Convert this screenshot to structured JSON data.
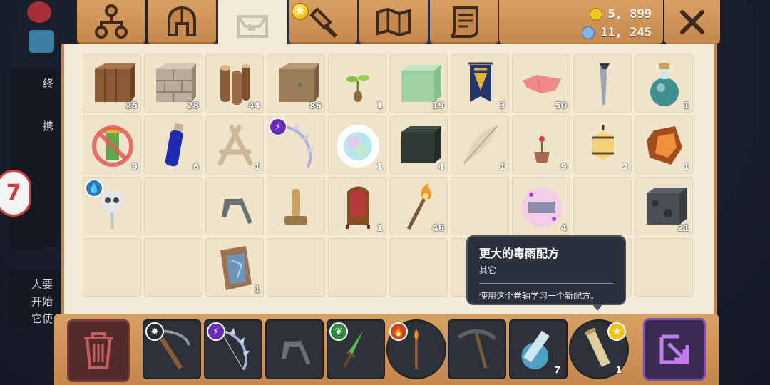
{
  "tabs": [
    {
      "name": "skills",
      "icon": "skill-tree-icon"
    },
    {
      "name": "equipment",
      "icon": "helmet-icon"
    },
    {
      "name": "inventory",
      "icon": "bag-icon",
      "active": true
    },
    {
      "name": "crafting",
      "icon": "hammer-icon",
      "has_star": true
    },
    {
      "name": "map",
      "icon": "map-icon"
    },
    {
      "name": "quests",
      "icon": "scroll-icon"
    }
  ],
  "currency": {
    "gold": "5, 899",
    "gems": "11, 245"
  },
  "inventory": {
    "rows": [
      [
        {
          "icon": "wood-block-icon",
          "count": "25"
        },
        {
          "icon": "stone-brick-icon",
          "count": "28"
        },
        {
          "icon": "logs-icon",
          "count": "44"
        },
        {
          "icon": "dirt-block-icon",
          "count": "86"
        },
        {
          "icon": "seedling-icon",
          "count": "1"
        },
        {
          "icon": "green-block-icon",
          "count": "19"
        },
        {
          "icon": "banner-icon",
          "count": "3"
        },
        {
          "icon": "pink-paper-icon",
          "count": "50"
        },
        {
          "icon": "metal-spike-icon",
          "count": ""
        },
        {
          "icon": "potion-icon",
          "count": "1"
        }
      ],
      [
        {
          "icon": "totem-forbidden-icon",
          "count": "9"
        },
        {
          "icon": "blue-vial-icon",
          "count": "6"
        },
        {
          "icon": "bone-frame-icon",
          "count": "1"
        },
        {
          "icon": "crystal-bow-icon",
          "count": "",
          "badge": "lightning"
        },
        {
          "icon": "rainbow-orb-icon",
          "count": "1"
        },
        {
          "icon": "dark-block-icon",
          "count": "4"
        },
        {
          "icon": "feather-icon",
          "count": "1"
        },
        {
          "icon": "flower-pot-icon",
          "count": "9"
        },
        {
          "icon": "lantern-icon",
          "count": "2"
        },
        {
          "icon": "amber-ore-icon",
          "count": "1"
        }
      ],
      [
        {
          "icon": "skull-staff-icon",
          "count": "",
          "badge": "water"
        },
        {
          "icon": "",
          "count": ""
        },
        {
          "icon": "flintlock-icon",
          "count": ""
        },
        {
          "icon": "brass-key-icon",
          "count": ""
        },
        {
          "icon": "throne-icon",
          "count": "1"
        },
        {
          "icon": "torch-icon",
          "count": "46"
        },
        {
          "icon": "",
          "count": ""
        },
        {
          "icon": "magic-scroll-icon",
          "count": "4"
        },
        {
          "icon": "",
          "count": ""
        },
        {
          "icon": "cobblestone-block-icon",
          "count": "21"
        }
      ],
      [
        {
          "icon": "",
          "count": ""
        },
        {
          "icon": "",
          "count": ""
        },
        {
          "icon": "",
          "count": ""
        },
        {
          "icon": "",
          "count": ""
        },
        {
          "icon": "",
          "count": ""
        },
        {
          "icon": "",
          "count": ""
        },
        {
          "icon": "",
          "count": ""
        },
        {
          "icon": "",
          "count": ""
        },
        {
          "icon": "",
          "count": ""
        },
        {
          "icon": "",
          "count": ""
        }
      ]
    ],
    "extra_item": {
      "row": 4,
      "col": 3,
      "icon": "crystal-shield-icon",
      "count": "1"
    }
  },
  "tooltip": {
    "title": "更大的毒雨配方",
    "category": "其它",
    "description": "使用这个卷轴学习一个新配方。"
  },
  "hotbar": [
    {
      "icon": "crossbow-icon",
      "count": "",
      "badge": "sun",
      "shape": "square"
    },
    {
      "icon": "crystal-bow-icon",
      "count": "",
      "badge": "lightning",
      "shape": "square"
    },
    {
      "icon": "flintlock-icon",
      "count": "",
      "badge": "",
      "shape": "square"
    },
    {
      "icon": "green-dagger-icon",
      "count": "",
      "badge": "leaf",
      "shape": "square"
    },
    {
      "icon": "fire-wand-icon",
      "count": "",
      "badge": "fire",
      "shape": "round"
    },
    {
      "icon": "pickaxe-icon",
      "count": "",
      "badge": "",
      "shape": "square"
    },
    {
      "icon": "glowing-scroll-icon",
      "count": "7",
      "badge": "",
      "shape": "square"
    },
    {
      "icon": "scroll-icon",
      "count": "1",
      "badge": "star",
      "shape": "round"
    }
  ],
  "background_hud": {
    "badge_text": "7",
    "side_text_1": "终",
    "side_text_2": "携",
    "side_text_3": "人要",
    "side_text_4": "开始",
    "side_text_5": "它使"
  },
  "colors": {
    "wood": "#c4864c",
    "parchment": "#f3ead7",
    "tooltip_bg": "#2b313c",
    "trash": "#7b3838",
    "craft": "#7b52b0"
  }
}
